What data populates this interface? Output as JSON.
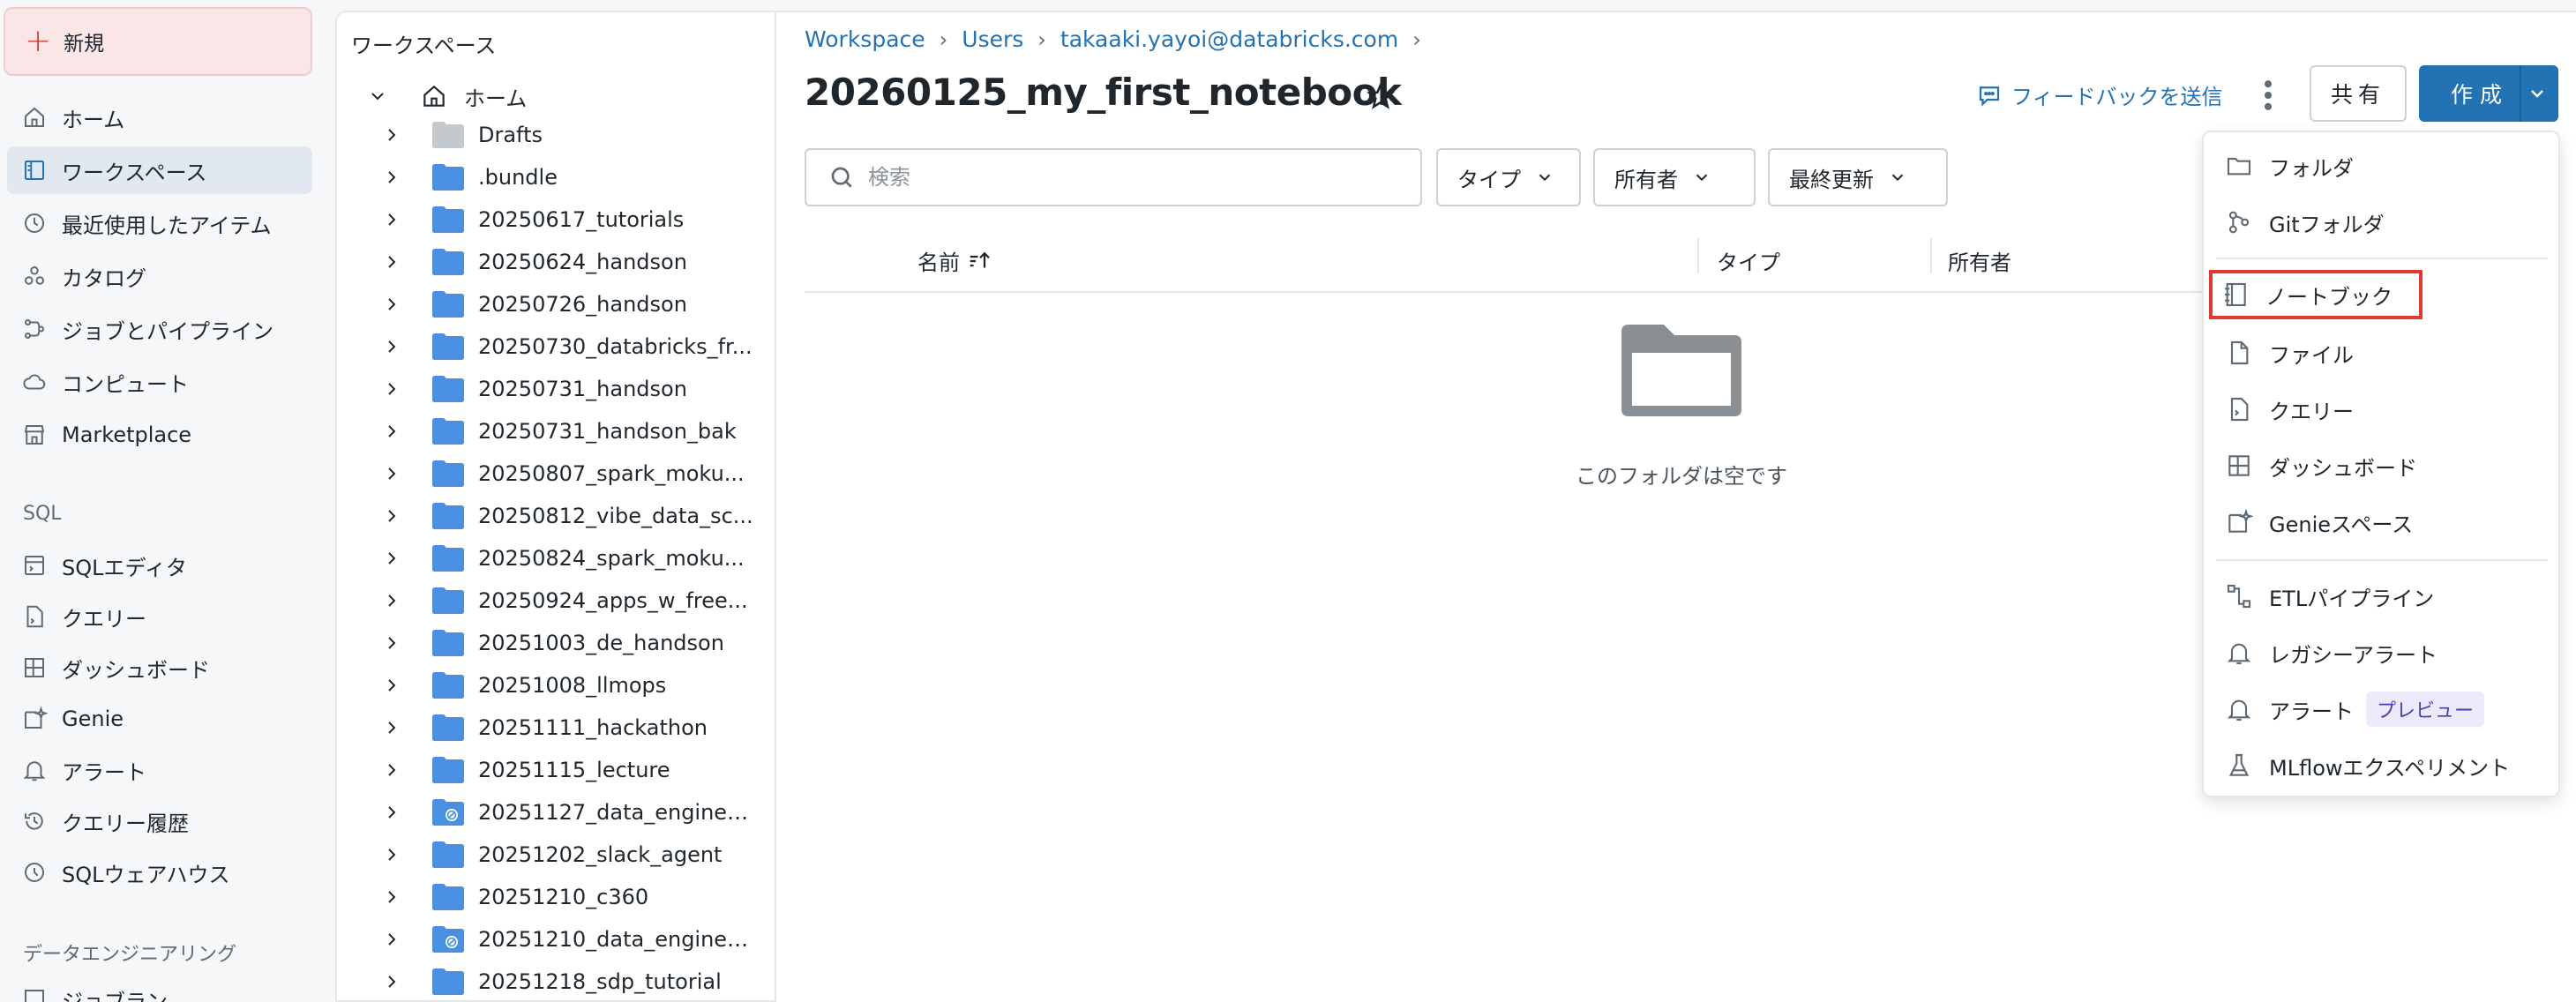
{
  "nav": {
    "new_label": "新規",
    "items": [
      {
        "label": "ホーム",
        "icon": "home-icon"
      },
      {
        "label": "ワークスペース",
        "icon": "workspace-icon"
      },
      {
        "label": "最近使用したアイテム",
        "icon": "clock-icon"
      },
      {
        "label": "カタログ",
        "icon": "catalog-icon"
      },
      {
        "label": "ジョブとパイプライン",
        "icon": "jobs-icon"
      },
      {
        "label": "コンピュート",
        "icon": "cloud-icon"
      },
      {
        "label": "Marketplace",
        "icon": "store-icon"
      }
    ],
    "sql_section": "SQL",
    "sql_items": [
      {
        "label": "SQLエディタ",
        "icon": "sql-editor-icon"
      },
      {
        "label": "クエリー",
        "icon": "query-icon"
      },
      {
        "label": "ダッシュボード",
        "icon": "dashboard-icon"
      },
      {
        "label": "Genie",
        "icon": "genie-icon"
      },
      {
        "label": "アラート",
        "icon": "bell-icon"
      },
      {
        "label": "クエリー履歴",
        "icon": "history-icon"
      },
      {
        "label": "SQLウェアハウス",
        "icon": "warehouse-icon"
      }
    ],
    "de_section": "データエンジニアリング",
    "de_partial": "ジョブラン"
  },
  "tree": {
    "title": "ワークスペース",
    "home_label": "ホーム",
    "items": [
      "Drafts",
      ".bundle",
      "20250617_tutorials",
      "20250624_handson",
      "20250726_handson",
      "20250730_databricks_fr...",
      "20250731_handson",
      "20250731_handson_bak",
      "20250807_spark_moku...",
      "20250812_vibe_data_sc...",
      "20250824_spark_moku...",
      "20250924_apps_w_free...",
      "20251003_de_handson",
      "20251008_llmops",
      "20251111_hackathon",
      "20251115_lecture",
      "20251127_data_engineer...",
      "20251202_slack_agent",
      "20251210_c360",
      "20251210_data_enginee...",
      "20251218_sdp_tutorial"
    ]
  },
  "breadcrumb": [
    "Workspace",
    "Users",
    "takaaki.yayoi@databricks.com"
  ],
  "page_title": "20260125_my_first_notebook",
  "header": {
    "feedback_label": "フィードバックを送信",
    "share_label": "共有",
    "create_label": "作成"
  },
  "filters": {
    "search_placeholder": "検索",
    "type_label": "タイプ",
    "owner_label": "所有者",
    "modified_label": "最終更新"
  },
  "table": {
    "col_name": "名前",
    "col_type": "タイプ",
    "col_owner": "所有者",
    "empty_text": "このフォルダは空です"
  },
  "create_menu": {
    "items": [
      {
        "label": "フォルダ",
        "icon": "folder-outline-icon"
      },
      {
        "label": "Gitフォルダ",
        "icon": "git-icon"
      },
      {
        "label": "ノートブック",
        "icon": "notebook-icon",
        "highlighted": true
      },
      {
        "label": "ファイル",
        "icon": "file-icon"
      },
      {
        "label": "クエリー",
        "icon": "query-file-icon"
      },
      {
        "label": "ダッシュボード",
        "icon": "dashboard-icon"
      },
      {
        "label": "Genieスペース",
        "icon": "genie-icon"
      },
      {
        "label": "ETLパイプライン",
        "icon": "pipeline-icon"
      },
      {
        "label": "レガシーアラート",
        "icon": "bell-icon"
      },
      {
        "label": "アラート",
        "icon": "bell-icon",
        "badge": "プレビュー"
      },
      {
        "label": "MLflowエクスペリメント",
        "icon": "flask-icon"
      }
    ]
  },
  "colors": {
    "accent": "#2272b4",
    "highlight_border": "#e03a2f",
    "folder_blue": "#4a90e2",
    "new_button_bg": "#fbe6e7"
  }
}
